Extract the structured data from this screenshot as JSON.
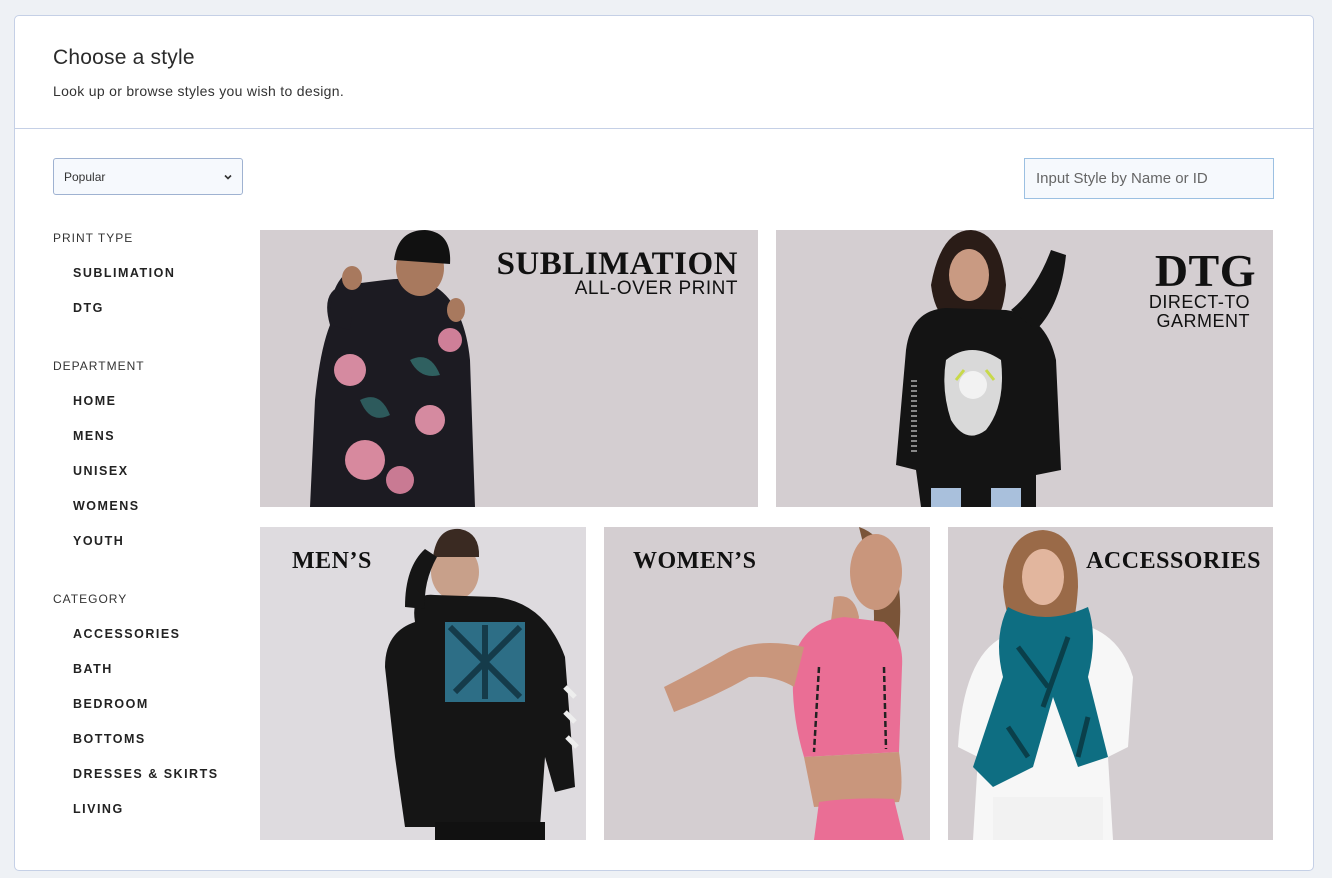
{
  "header": {
    "title": "Choose a style",
    "subtitle": "Look up or browse styles you wish to design."
  },
  "sort": {
    "selected": "Popular"
  },
  "search": {
    "placeholder": "Input Style by Name or ID",
    "value": ""
  },
  "filters": [
    {
      "heading": "PRINT TYPE",
      "items": [
        "SUBLIMATION",
        "DTG"
      ]
    },
    {
      "heading": "DEPARTMENT",
      "items": [
        "HOME",
        "MENS",
        "UNISEX",
        "WOMENS",
        "YOUTH"
      ]
    },
    {
      "heading": "CATEGORY",
      "items": [
        "ACCESSORIES",
        "BATH",
        "BEDROOM",
        "BOTTOMS",
        "DRESSES & SKIRTS",
        "LIVING"
      ]
    }
  ],
  "tiles": {
    "sublimation": {
      "title": "SUBLIMATION",
      "subtitle": "ALL-OVER PRINT"
    },
    "dtg": {
      "title": "DTG",
      "subtitle_line1": "DIRECT-TO",
      "subtitle_line2": "GARMENT"
    },
    "mens": {
      "title": "MEN’S"
    },
    "womens": {
      "title": "WOMEN’S"
    },
    "accessories": {
      "title": "ACCESSORIES"
    }
  },
  "colors": {
    "tile_background": "#d4ced1",
    "panel_border": "#c5d0e6",
    "page_background": "#eef1f5"
  },
  "icons": {
    "sort_dropdown": "chevron-down-icon"
  }
}
